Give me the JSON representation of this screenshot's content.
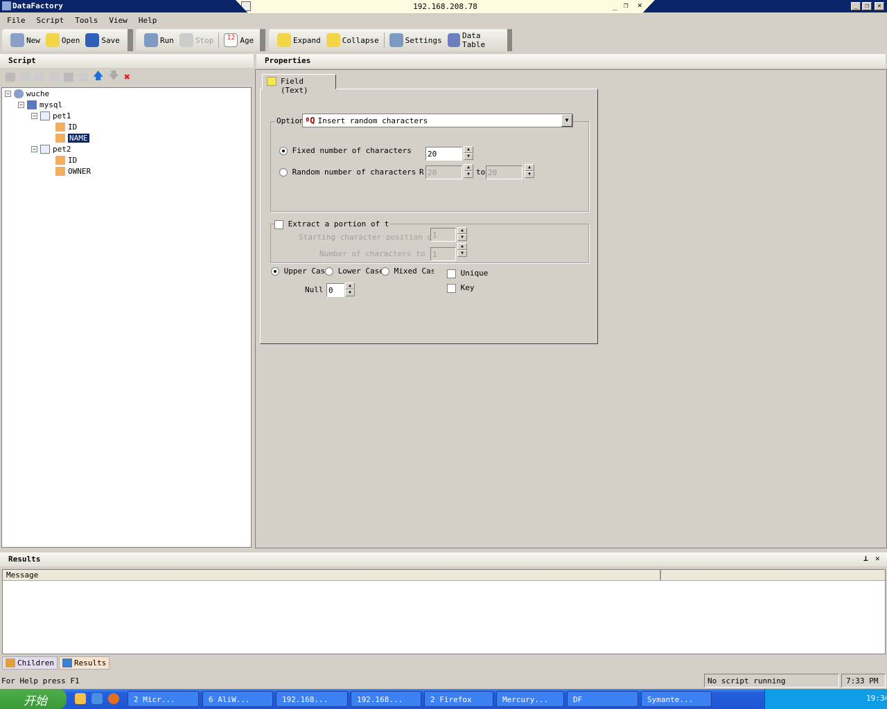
{
  "app_title": "DataFactory",
  "remote_ip": "192.168.208.78",
  "menu": [
    "File",
    "Script",
    "Tools",
    "View",
    "Help"
  ],
  "toolbar1": [
    "New",
    "Open",
    "Save"
  ],
  "toolbar2": [
    "Run",
    "Stop",
    "Age"
  ],
  "toolbar3": [
    "Expand",
    "Collapse",
    "Settings",
    "Data Table"
  ],
  "script_panel": {
    "title": "Script",
    "tree": [
      {
        "label": "wuche",
        "level": 0
      },
      {
        "label": "mysql",
        "level": 1
      },
      {
        "label": "pet1",
        "level": 2
      },
      {
        "label": "ID",
        "level": 3
      },
      {
        "label": "NAME",
        "level": 3,
        "selected": true
      },
      {
        "label": "pet2",
        "level": 2
      },
      {
        "label": "ID",
        "level": 3
      },
      {
        "label": "OWNER",
        "level": 3
      }
    ]
  },
  "properties": {
    "title": "Properties",
    "tab": "Field (Text)",
    "option_label": "Option",
    "option_value": "Insert random characters",
    "fixed_label": "Fixed number of characters",
    "fixed_value": "20",
    "random_label": "Random number of characters",
    "r_label": "R",
    "random_from": "20",
    "to_label": "to",
    "random_to": "20",
    "extract_label": "Extract a portion of t",
    "start_label": "Starting character position of",
    "start_value": "1",
    "num_label": "Number of characters to",
    "num_value": "1",
    "upper": "Upper Case",
    "lower": "Lower Case",
    "mixed": "Mixed Case",
    "unique": "Unique",
    "key": "Key",
    "null_label": "Null",
    "null_value": "0"
  },
  "results": {
    "title": "Results",
    "column": "Message"
  },
  "bottom_tabs": [
    "Children",
    "Results"
  ],
  "status": {
    "help": "For Help press F1",
    "script": "No script running",
    "time": "7:33 PM"
  },
  "taskbar": {
    "start": "开始",
    "tasks": [
      "2 Micr...",
      "6 AliW...",
      "192.168...",
      "192.168...",
      "2 Firefox",
      "Mercury...",
      "DF",
      "Symante..."
    ],
    "clock": "19:34"
  }
}
